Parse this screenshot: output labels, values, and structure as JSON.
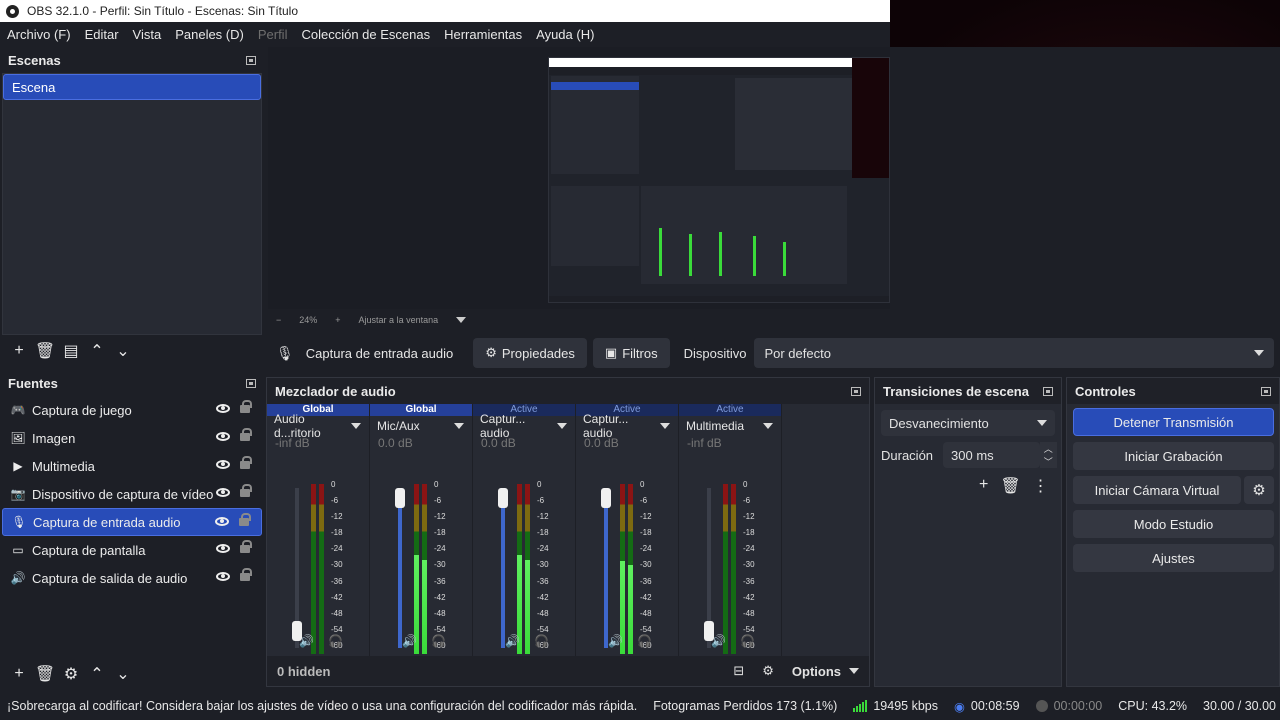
{
  "window": {
    "title": "OBS 32.1.0 - Perfil: Sin Título - Escenas: Sin Título"
  },
  "menu": [
    {
      "label": "Archivo (F)",
      "disabled": false
    },
    {
      "label": "Editar",
      "disabled": false
    },
    {
      "label": "Vista",
      "disabled": false
    },
    {
      "label": "Paneles (D)",
      "disabled": false
    },
    {
      "label": "Perfil",
      "disabled": true
    },
    {
      "label": "Colección de Escenas",
      "disabled": false
    },
    {
      "label": "Herramientas",
      "disabled": false
    },
    {
      "label": "Ayuda (H)",
      "disabled": false
    }
  ],
  "scenes": {
    "title": "Escenas",
    "items": [
      "Escena"
    ]
  },
  "preview": {
    "zoom": "24%",
    "fit_label": "Ajustar a la ventana",
    "zoom_out": "−",
    "zoom_in": "+"
  },
  "context_bar": {
    "source_name": "Captura de entrada audio",
    "properties": "Propiedades",
    "filters": "Filtros",
    "device_label": "Dispositivo",
    "device_value": "Por defecto"
  },
  "sources": {
    "title": "Fuentes",
    "items": [
      {
        "label": "Captura de juego",
        "icon": "gamepad-icon"
      },
      {
        "label": "Imagen",
        "icon": "image-icon"
      },
      {
        "label": "Multimedia",
        "icon": "play-icon"
      },
      {
        "label": "Dispositivo de captura de vídeo",
        "icon": "camera-icon"
      },
      {
        "label": "Captura de entrada audio",
        "icon": "microphone-icon"
      },
      {
        "label": "Captura de pantalla",
        "icon": "monitor-icon"
      },
      {
        "label": "Captura de salida de audio",
        "icon": "speaker-icon"
      }
    ]
  },
  "mixer": {
    "title": "Mezclador de audio",
    "hidden_label": "0 hidden",
    "options_label": "Options",
    "scale": [
      "0",
      "-6",
      "-12",
      "-18",
      "-24",
      "-30",
      "-36",
      "-42",
      "-48",
      "-54",
      "-60"
    ],
    "channels": [
      {
        "state": "Global",
        "name": "Audio d...ritorio",
        "db": "-inf dB",
        "fader": 0.05,
        "level": 0.0,
        "muted_color": false
      },
      {
        "state": "Global",
        "name": "Mic/Aux",
        "db": "0.0 dB",
        "fader": 1.0,
        "level": 0.58,
        "muted_color": false
      },
      {
        "state": "Active",
        "name": "Captur... audio",
        "db": "0.0 dB",
        "fader": 1.0,
        "level": 0.58,
        "muted_color": false
      },
      {
        "state": "Active",
        "name": "Captur... audio",
        "db": "0.0 dB",
        "fader": 1.0,
        "level": 0.55,
        "muted_color": false
      },
      {
        "state": "Active",
        "name": "Multimedia",
        "db": "-inf dB",
        "fader": 0.05,
        "level": 0.0,
        "muted_color": false
      }
    ]
  },
  "transitions": {
    "title": "Transiciones de escena",
    "selected": "Desvanecimiento",
    "duration_label": "Duración",
    "duration_value": "300 ms"
  },
  "controls": {
    "title": "Controles",
    "buttons": [
      "Detener Transmisión",
      "Iniciar Grabación",
      "Iniciar Cámara Virtual",
      "Modo Estudio",
      "Ajustes"
    ]
  },
  "status": {
    "warning": "¡Sobrecarga al codificar! Considera bajar los ajustes de vídeo o usa una configuración del codificador más rápida.",
    "dropped_frames": "Fotogramas Perdidos 173 (1.1%)",
    "bitrate": "19495 kbps",
    "stream_time": "00:08:59",
    "rec_time": "00:00:00",
    "cpu": "CPU: 43.2%",
    "fps": "30.00 / 30.00 FPS"
  },
  "colors": {
    "accent": "#284cb8",
    "meter_green": "#3adb3a",
    "background": "#1d1f26"
  }
}
